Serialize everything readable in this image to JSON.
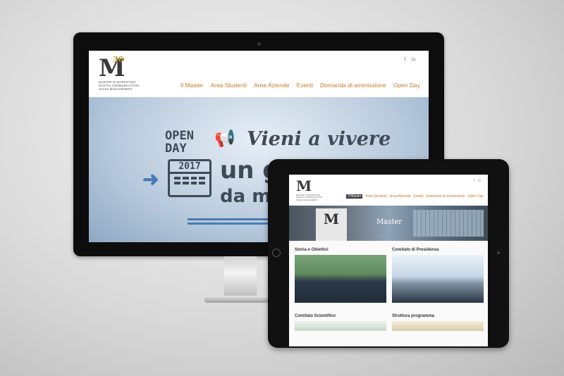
{
  "desktop": {
    "logo": {
      "letter": "M",
      "number": "30",
      "lines": [
        "MASTER IN MARKETING",
        "DIGITAL COMMUNICATION",
        "SALES MANAGEMENT"
      ]
    },
    "social": [
      "f",
      "in"
    ],
    "nav": [
      "Il Master",
      "Area Studenti",
      "Area Aziende",
      "Eventi",
      "Domanda di ammissione",
      "Open Day"
    ],
    "hero": {
      "open_line1": "OPEN",
      "open_line2": "DAY",
      "year": "2017",
      "headline1": "Vieni a vivere",
      "headline2": "un gi",
      "headline3": "da m",
      "exclamation": "!"
    }
  },
  "tablet": {
    "social": [
      "f",
      "in"
    ],
    "nav": [
      "Il Master",
      "Area Studenti",
      "Area Aziende",
      "Eventi",
      "Domanda di ammissione",
      "Open Day"
    ],
    "hero_sign": "M",
    "hero_sign2": "Master",
    "cards": [
      {
        "title": "Storia e Obiettivi"
      },
      {
        "title": "Comitato di Presidenza"
      },
      {
        "title": "Comitato Scientifico"
      },
      {
        "title": "Struttura programma"
      }
    ]
  }
}
